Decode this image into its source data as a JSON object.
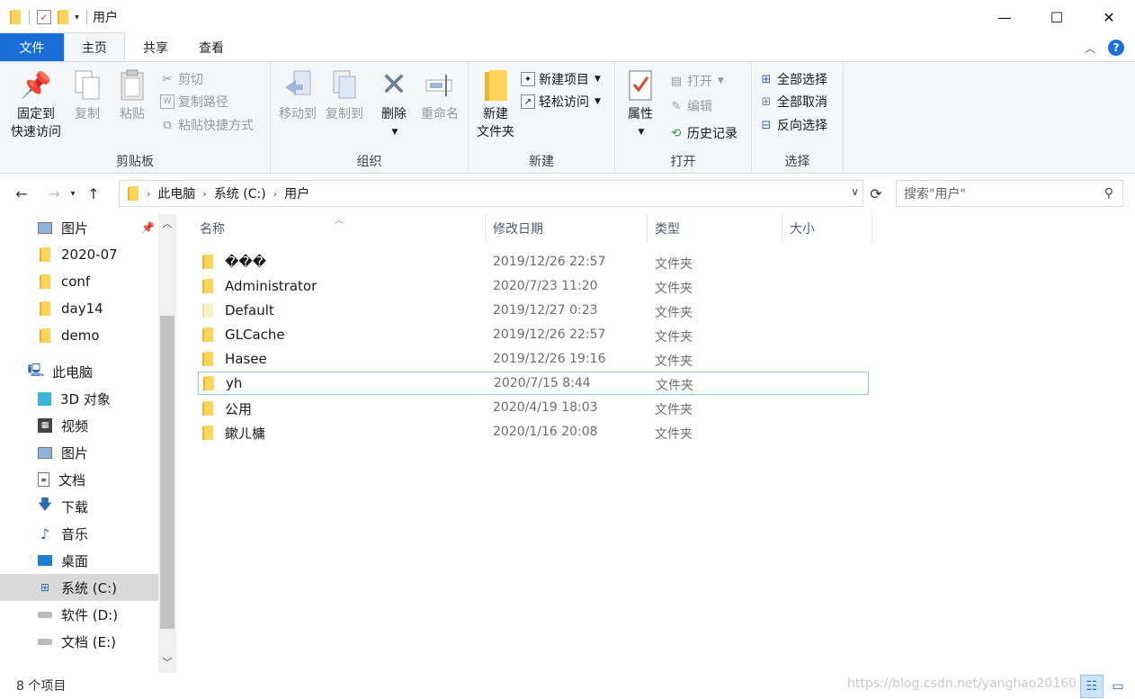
{
  "window": {
    "title": "用户",
    "minimize": "—",
    "maximize": "☐",
    "close": "✕"
  },
  "tabs": [
    {
      "label": "文件"
    },
    {
      "label": "主页"
    },
    {
      "label": "共享"
    },
    {
      "label": "查看"
    }
  ],
  "ribbon": {
    "clipboard": {
      "pin_line1": "固定到",
      "pin_line2": "快速访问",
      "copy": "复制",
      "paste": "粘贴",
      "cut": "剪切",
      "copy_path": "复制路径",
      "paste_shortcut": "粘贴快捷方式",
      "label": "剪贴板"
    },
    "organize": {
      "move_to": "移动到",
      "copy_to": "复制到",
      "delete": "删除",
      "rename": "重命名",
      "label": "组织"
    },
    "new": {
      "new_folder_line1": "新建",
      "new_folder_line2": "文件夹",
      "new_item": "新建项目",
      "easy_access": "轻松访问",
      "label": "新建"
    },
    "open": {
      "properties": "属性",
      "open": "打开",
      "edit": "编辑",
      "history": "历史记录",
      "label": "打开"
    },
    "select": {
      "select_all": "全部选择",
      "select_none": "全部取消",
      "invert": "反向选择",
      "label": "选择"
    }
  },
  "address": {
    "crumbs": [
      "此电脑",
      "系统 (C:)",
      "用户"
    ],
    "search_placeholder": "搜索\"用户\""
  },
  "nav": {
    "quick": [
      {
        "label": "图片",
        "icon": "pictures-icon"
      },
      {
        "label": "2020-07",
        "icon": "folder-icon"
      },
      {
        "label": "conf",
        "icon": "folder-icon"
      },
      {
        "label": "day14",
        "icon": "folder-icon"
      },
      {
        "label": "demo",
        "icon": "folder-icon"
      }
    ],
    "this_pc": "此电脑",
    "pc_items": [
      {
        "label": "3D 对象",
        "icon": "3d-objects-icon"
      },
      {
        "label": "视频",
        "icon": "videos-icon"
      },
      {
        "label": "图片",
        "icon": "pictures-icon"
      },
      {
        "label": "文档",
        "icon": "documents-icon"
      },
      {
        "label": "下载",
        "icon": "downloads-icon"
      },
      {
        "label": "音乐",
        "icon": "music-icon"
      },
      {
        "label": "桌面",
        "icon": "desktop-icon"
      },
      {
        "label": "系统 (C:)",
        "icon": "drive-c-icon"
      },
      {
        "label": "软件 (D:)",
        "icon": "drive-icon"
      },
      {
        "label": "文档 (E:)",
        "icon": "drive-icon"
      }
    ]
  },
  "columns": {
    "name": "名称",
    "date": "修改日期",
    "type": "类型",
    "size": "大小"
  },
  "files": [
    {
      "name": "���",
      "date": "2019/12/26 22:57",
      "type": "文件夹"
    },
    {
      "name": "Administrator",
      "date": "2020/7/23 11:20",
      "type": "文件夹"
    },
    {
      "name": "Default",
      "date": "2019/12/27 0:23",
      "type": "文件夹"
    },
    {
      "name": "GLCache",
      "date": "2019/12/26 22:57",
      "type": "文件夹"
    },
    {
      "name": "Hasee",
      "date": "2019/12/26 19:16",
      "type": "文件夹"
    },
    {
      "name": "yh",
      "date": "2020/7/15 8:44",
      "type": "文件夹"
    },
    {
      "name": "公用",
      "date": "2020/4/19 18:03",
      "type": "文件夹"
    },
    {
      "name": "鏉ㄦ槦",
      "date": "2020/1/16 20:08",
      "type": "文件夹"
    }
  ],
  "status": {
    "count": "8 个项目",
    "watermark": "https://blog.csdn.net/yanghao20160"
  }
}
